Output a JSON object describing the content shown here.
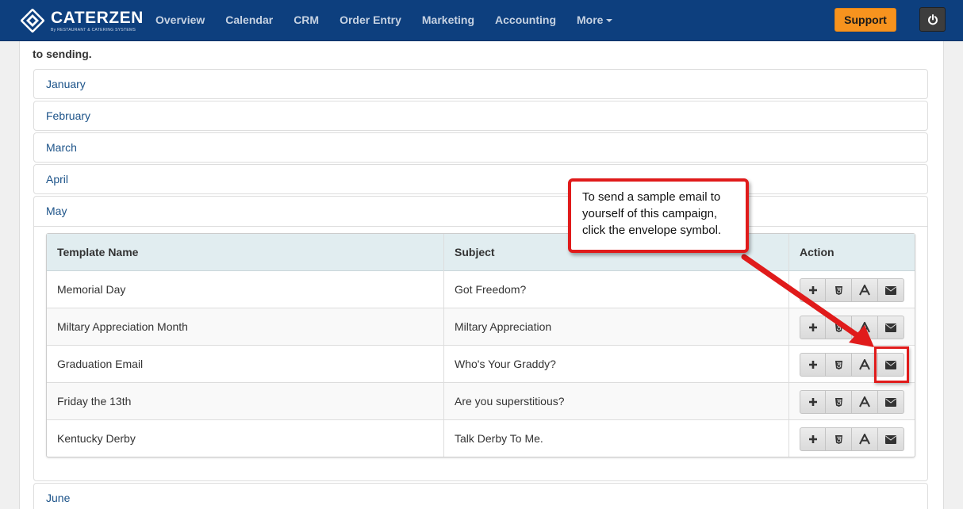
{
  "nav": {
    "brand": "CATERZEN",
    "tagline": "By RESTAURANT & CATERING SYSTEMS",
    "items": [
      "Overview",
      "Calendar",
      "CRM",
      "Order Entry",
      "Marketing",
      "Accounting",
      "More"
    ],
    "support_label": "Support",
    "colors": {
      "bar": "#0d3f7e",
      "support": "#f7931e"
    }
  },
  "intro_text": "to sending.",
  "months": [
    "January",
    "February",
    "March",
    "April",
    "May",
    "June"
  ],
  "table": {
    "headers": [
      "Template Name",
      "Subject",
      "Action"
    ],
    "rows": [
      {
        "name": "Memorial Day",
        "subject": "Got Freedom?"
      },
      {
        "name": "Miltary Appreciation Month",
        "subject": "Miltary Appreciation"
      },
      {
        "name": "Graduation Email",
        "subject": "Who's Your Graddy?"
      },
      {
        "name": "Friday the 13th",
        "subject": "Are you superstitious?"
      },
      {
        "name": "Kentucky Derby",
        "subject": "Talk Derby To Me."
      }
    ],
    "actions": [
      "plus-icon",
      "html5-icon",
      "font-icon",
      "envelope-icon"
    ]
  },
  "callout": {
    "line1": "To send a sample email to",
    "line2": "yourself of this campaign,",
    "line3": "click the envelope symbol.",
    "color": "#e01b1b"
  }
}
